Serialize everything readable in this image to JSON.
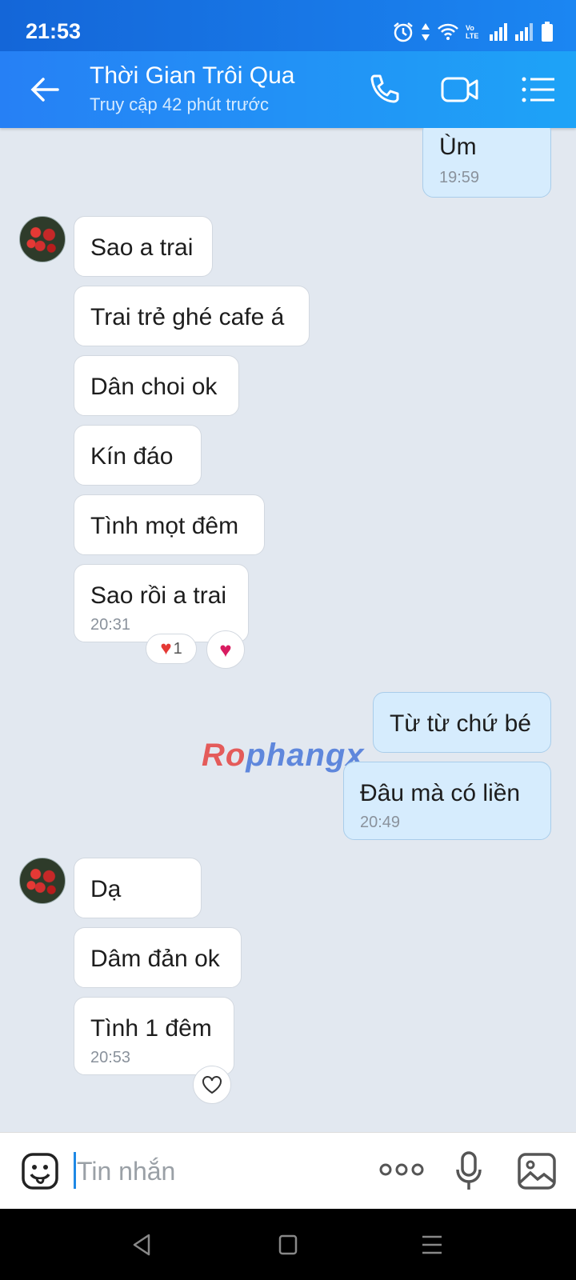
{
  "status": {
    "time": "21:53",
    "volte": "Vo LTE"
  },
  "header": {
    "title": "Thời Gian Trôi Qua",
    "subtitle": "Truy cập 42 phút trước"
  },
  "messages": [
    {
      "dir": "out",
      "text": "Ùm",
      "time": "19:59"
    },
    {
      "dir": "in",
      "text": "Sao a trai"
    },
    {
      "dir": "in",
      "text": "Trai trẻ ghé cafe á"
    },
    {
      "dir": "in",
      "text": "Dân choi ok"
    },
    {
      "dir": "in",
      "text": "Kín đáo"
    },
    {
      "dir": "in",
      "text": "Tình mọt đêm"
    },
    {
      "dir": "in",
      "text": "Sao rồi a trai",
      "time": "20:31"
    },
    {
      "dir": "out",
      "text": "Từ từ chứ bé"
    },
    {
      "dir": "out",
      "text": "Đâu mà có liền",
      "time": "20:49"
    },
    {
      "dir": "in",
      "text": "Dạ"
    },
    {
      "dir": "in",
      "text": "Dâm đản ok"
    },
    {
      "dir": "in",
      "text": "Tình 1 đêm",
      "time": "20:53"
    }
  ],
  "reaction": {
    "icon": "heart-icon",
    "count": "1"
  },
  "watermark": {
    "part1": "Ro",
    "part2": "phangx"
  },
  "input": {
    "placeholder": "Tin nhắn"
  },
  "colors": {
    "header": "#1e8af3",
    "outgoing_bubble": "#d6ecfd",
    "incoming_bubble": "#ffffff",
    "background": "#e2e8f0"
  }
}
